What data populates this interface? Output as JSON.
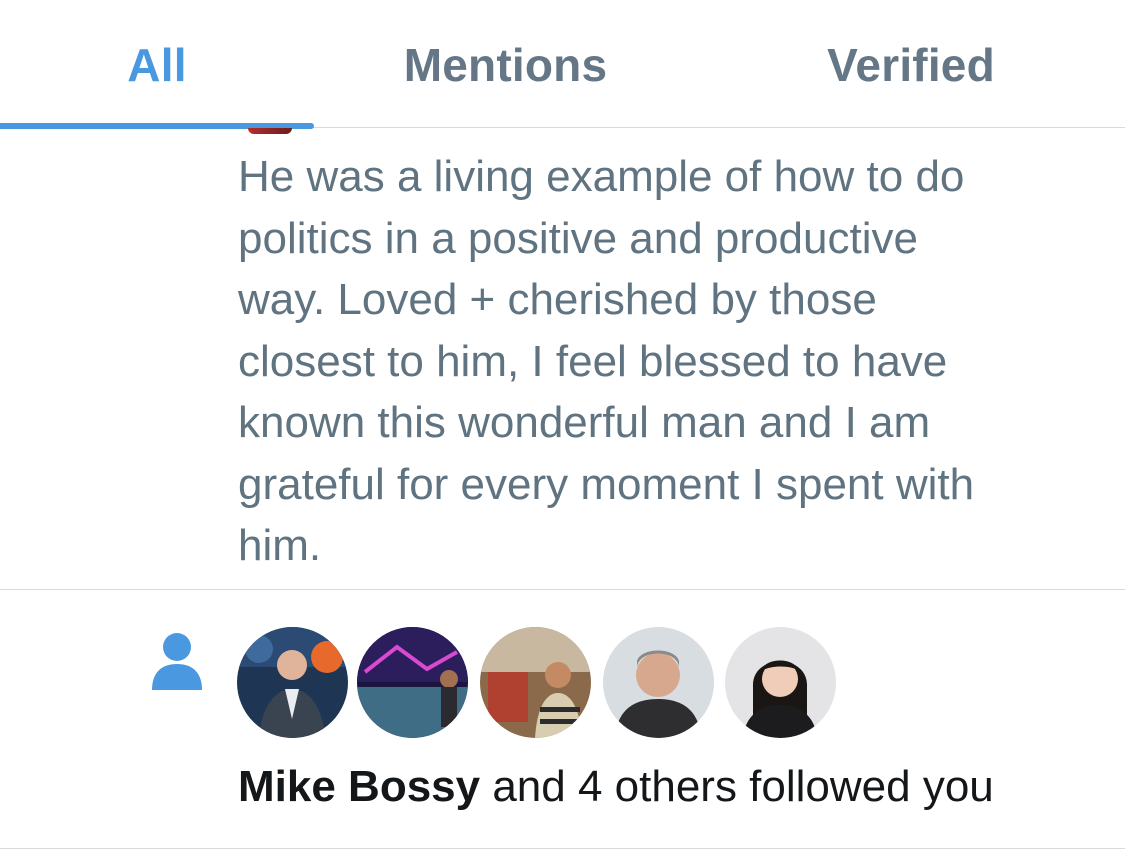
{
  "tabs": {
    "all": "All",
    "mentions": "Mentions",
    "verified": "Verified"
  },
  "tweet": {
    "text": "He was a living example of how to do\npolitics in a positive and productive\nway. Loved + cherished  by those\nclosest to  him, I feel blessed to have\nknown this wonderful man and I am\ngrateful for every moment I spent with\nhim."
  },
  "follow_notification": {
    "icon": "person-icon",
    "name": "Mike Bossy",
    "rest": " and 4 others followed you",
    "avatar_count": 5
  },
  "colors": {
    "accent": "#4a98e0",
    "tab_inactive": "#657786",
    "tweet_text": "#5f7381",
    "primary_text": "#14171a",
    "divider": "#d6dbe0"
  }
}
